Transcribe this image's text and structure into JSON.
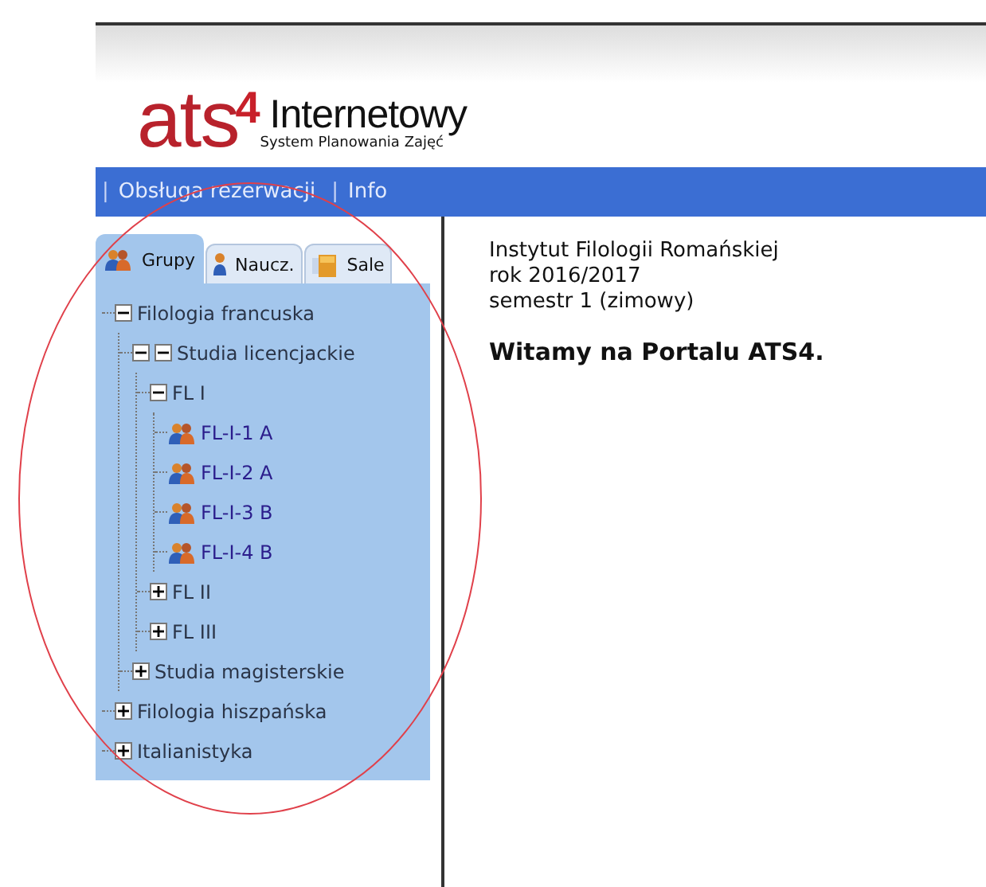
{
  "logo": {
    "mark": "ats",
    "mark_suffix": "4",
    "product": "Internetowy",
    "subtitle": "System Planowania Zajęć"
  },
  "nav": [
    {
      "separator": "|",
      "label": "Obsługa rezerwacji"
    },
    {
      "separator": "|",
      "label": "Info"
    }
  ],
  "tabs": [
    {
      "label": "Grupy",
      "selected": true
    },
    {
      "label": "Naucz.",
      "selected": false
    },
    {
      "label": "Sale",
      "selected": false
    }
  ],
  "tree": [
    {
      "label": "Filologia francuska",
      "kind": "folder",
      "expanded": true,
      "children": [
        {
          "label": "Studia licencjackie",
          "kind": "folder",
          "expanded": true,
          "double_toggle": true,
          "children": [
            {
              "label": "FL I",
              "kind": "folder",
              "expanded": true,
              "children": [
                {
                  "label": "FL-I-1 A",
                  "kind": "group"
                },
                {
                  "label": "FL-I-2 A",
                  "kind": "group"
                },
                {
                  "label": "FL-I-3 B",
                  "kind": "group"
                },
                {
                  "label": "FL-I-4 B",
                  "kind": "group"
                }
              ]
            },
            {
              "label": "FL II",
              "kind": "folder",
              "expanded": false
            },
            {
              "label": "FL III",
              "kind": "folder",
              "expanded": false
            }
          ]
        },
        {
          "label": "Studia magisterskie",
          "kind": "folder",
          "expanded": false
        }
      ]
    },
    {
      "label": "Filologia hiszpańska",
      "kind": "folder",
      "expanded": false
    },
    {
      "label": "Italianistyka",
      "kind": "folder",
      "expanded": false
    }
  ],
  "info": {
    "lines": [
      "Instytut Filologii Romańskiej",
      "rok 2016/2017",
      "semestr 1 (zimowy)"
    ],
    "heading": "Witamy na Portalu ATS4."
  },
  "annotation": {
    "kind": "ellipse"
  }
}
